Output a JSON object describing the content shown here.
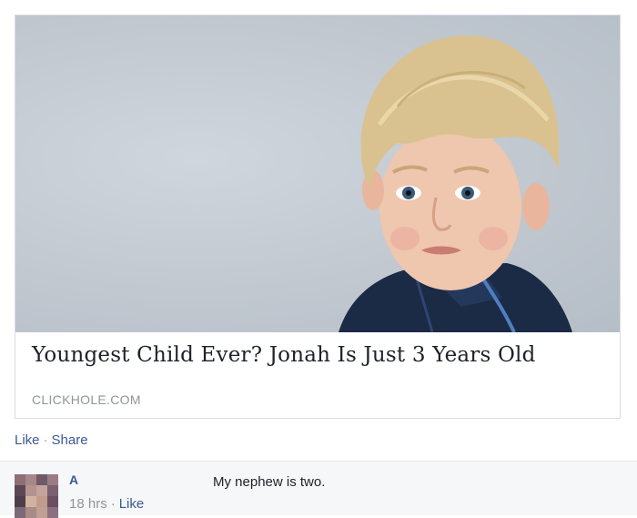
{
  "link_card": {
    "title": "Youngest Child Ever? Jonah Is Just 3 Years Old",
    "domain": "CLICKHOLE.COM",
    "image_subject": "photo-of-boy"
  },
  "actions": {
    "like_label": "Like",
    "separator": "·",
    "share_label": "Share"
  },
  "comment": {
    "author": "A",
    "time": "18 hrs",
    "separator": "·",
    "like_label": "Like",
    "text": "My nephew is two."
  },
  "colors": {
    "link_blue": "#3b5998",
    "muted_gray": "#90949c",
    "text_dark": "#1d2129"
  }
}
